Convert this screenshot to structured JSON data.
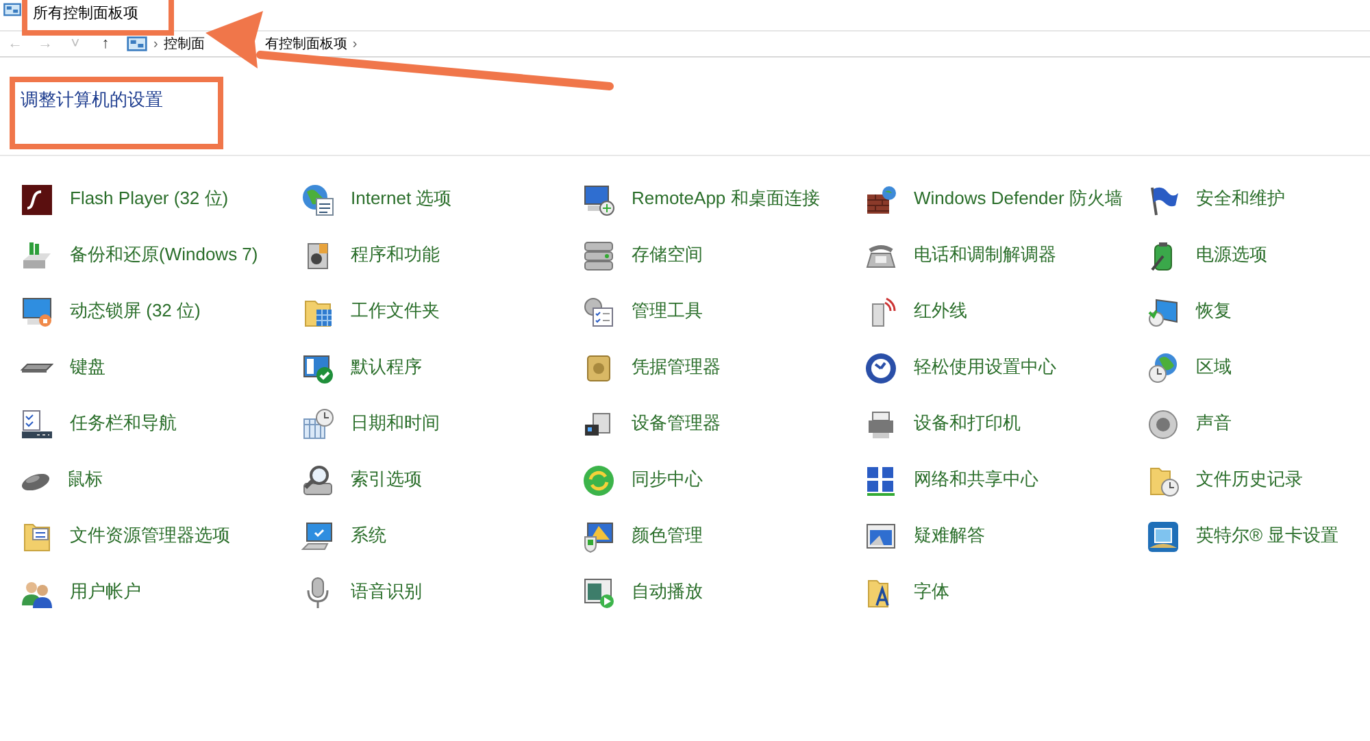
{
  "window": {
    "title": "所有控制面板项",
    "title_highlighted": true
  },
  "address_bar": {
    "back": "←",
    "forward": "→",
    "recent": "˅",
    "up": "↑",
    "crumbs": [
      "控制面",
      "有控制面板项"
    ],
    "separator": "›"
  },
  "heading": {
    "text": "调整计算机的设置",
    "highlighted": true
  },
  "annotation_arrow": true,
  "items": [
    {
      "label": "Flash Player (32 位)"
    },
    {
      "label": "Internet 选项"
    },
    {
      "label": "RemoteApp 和桌面连接"
    },
    {
      "label": "Windows Defender 防火墙"
    },
    {
      "label": "安全和维护"
    },
    {
      "label": "备份和还原(Windows 7)"
    },
    {
      "label": "程序和功能"
    },
    {
      "label": "存储空间"
    },
    {
      "label": "电话和调制解调器"
    },
    {
      "label": "电源选项"
    },
    {
      "label": "动态锁屏 (32 位)"
    },
    {
      "label": "工作文件夹"
    },
    {
      "label": "管理工具"
    },
    {
      "label": "红外线"
    },
    {
      "label": "恢复"
    },
    {
      "label": "键盘"
    },
    {
      "label": "默认程序"
    },
    {
      "label": "凭据管理器"
    },
    {
      "label": "轻松使用设置中心"
    },
    {
      "label": "区域"
    },
    {
      "label": "任务栏和导航"
    },
    {
      "label": "日期和时间"
    },
    {
      "label": "设备管理器"
    },
    {
      "label": "设备和打印机"
    },
    {
      "label": "声音"
    },
    {
      "label": "鼠标"
    },
    {
      "label": "索引选项"
    },
    {
      "label": "同步中心"
    },
    {
      "label": "网络和共享中心"
    },
    {
      "label": "文件历史记录"
    },
    {
      "label": "文件资源管理器选项"
    },
    {
      "label": "系统"
    },
    {
      "label": "颜色管理"
    },
    {
      "label": "疑难解答"
    },
    {
      "label": "英特尔® 显卡设置"
    },
    {
      "label": "用户帐户"
    },
    {
      "label": "语音识别"
    },
    {
      "label": "自动播放"
    },
    {
      "label": "字体"
    }
  ]
}
